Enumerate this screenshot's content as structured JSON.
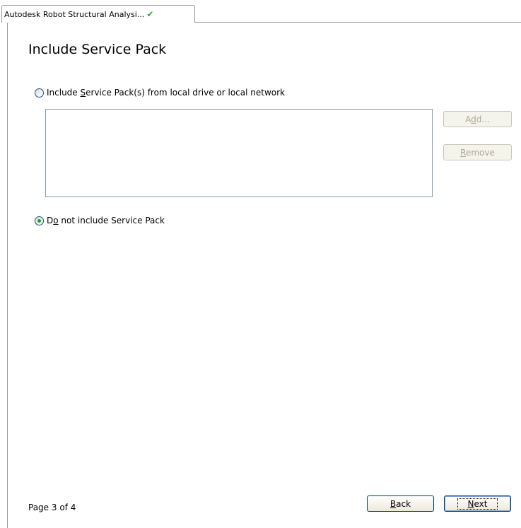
{
  "tab": {
    "label": "Autodesk Robot Structural Analysi...",
    "check_icon": "checkmark-icon",
    "check_color": "#2da62d"
  },
  "page_title": "Include Service Pack",
  "options": {
    "include_local": {
      "pre": "Include ",
      "mnemonic": "S",
      "post": "ervice Pack(s) from local drive or local network",
      "selected": false
    },
    "do_not_include": {
      "pre": "D",
      "mnemonic": "o",
      "post": " not include Service Pack",
      "selected": true
    }
  },
  "service_pack_list": {
    "items": []
  },
  "buttons": {
    "add": {
      "pre": "A",
      "mnemonic": "d",
      "post": "d...",
      "enabled": false
    },
    "remove": {
      "pre": "",
      "mnemonic": "R",
      "post": "emove",
      "enabled": false
    },
    "back": {
      "pre": "",
      "mnemonic": "B",
      "post": "ack",
      "enabled": true
    },
    "next": {
      "pre": "",
      "mnemonic": "N",
      "post": "ext",
      "enabled": true
    }
  },
  "footer": {
    "page_indicator": "Page 3 of 4"
  }
}
